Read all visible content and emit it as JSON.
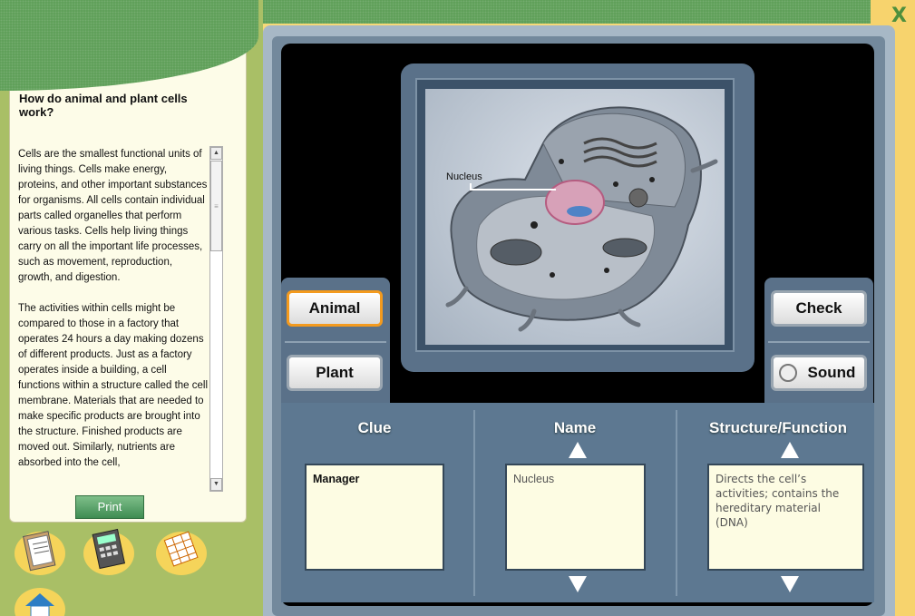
{
  "window": {
    "close_label": "X"
  },
  "left_panel": {
    "question": "How do animal and plant cells work?",
    "paragraphs": [
      "Cells are the smallest functional units of living things. Cells make energy, proteins, and other important substances for organisms. All cells contain individual parts called organelles that perform various tasks. Cells help living things carry on all the important life processes, such as movement, reproduction, growth, and digestion.",
      "The activities within cells might be compared to those in a factory that operates 24 hours a day making dozens of different products. Just as a factory operates inside a building, a cell functions within a structure called the cell membrane. Materials that are needed to make specific products are brought into the structure. Finished products are moved out. Similarly, nutrients are absorbed into the cell,"
    ],
    "print_label": "Print"
  },
  "tools": {
    "notepad": "clipboard-icon",
    "calculator": "calculator-icon",
    "spreadsheet": "table-icon",
    "home": "home-icon"
  },
  "image": {
    "label": "Nucleus"
  },
  "buttons": {
    "animal": "Animal",
    "plant": "Plant",
    "check": "Check",
    "sound": "Sound"
  },
  "columns": {
    "clue": {
      "header": "Clue",
      "value": "Manager"
    },
    "name": {
      "header": "Name",
      "value": "Nucleus"
    },
    "function": {
      "header": "Structure/Function",
      "value": "Directs the cell’s activities; contains the hereditary material (DNA)"
    }
  },
  "colors": {
    "accent_orange": "#f39a1e",
    "green": "#5c9e56",
    "panel_blue": "#5d7891"
  }
}
